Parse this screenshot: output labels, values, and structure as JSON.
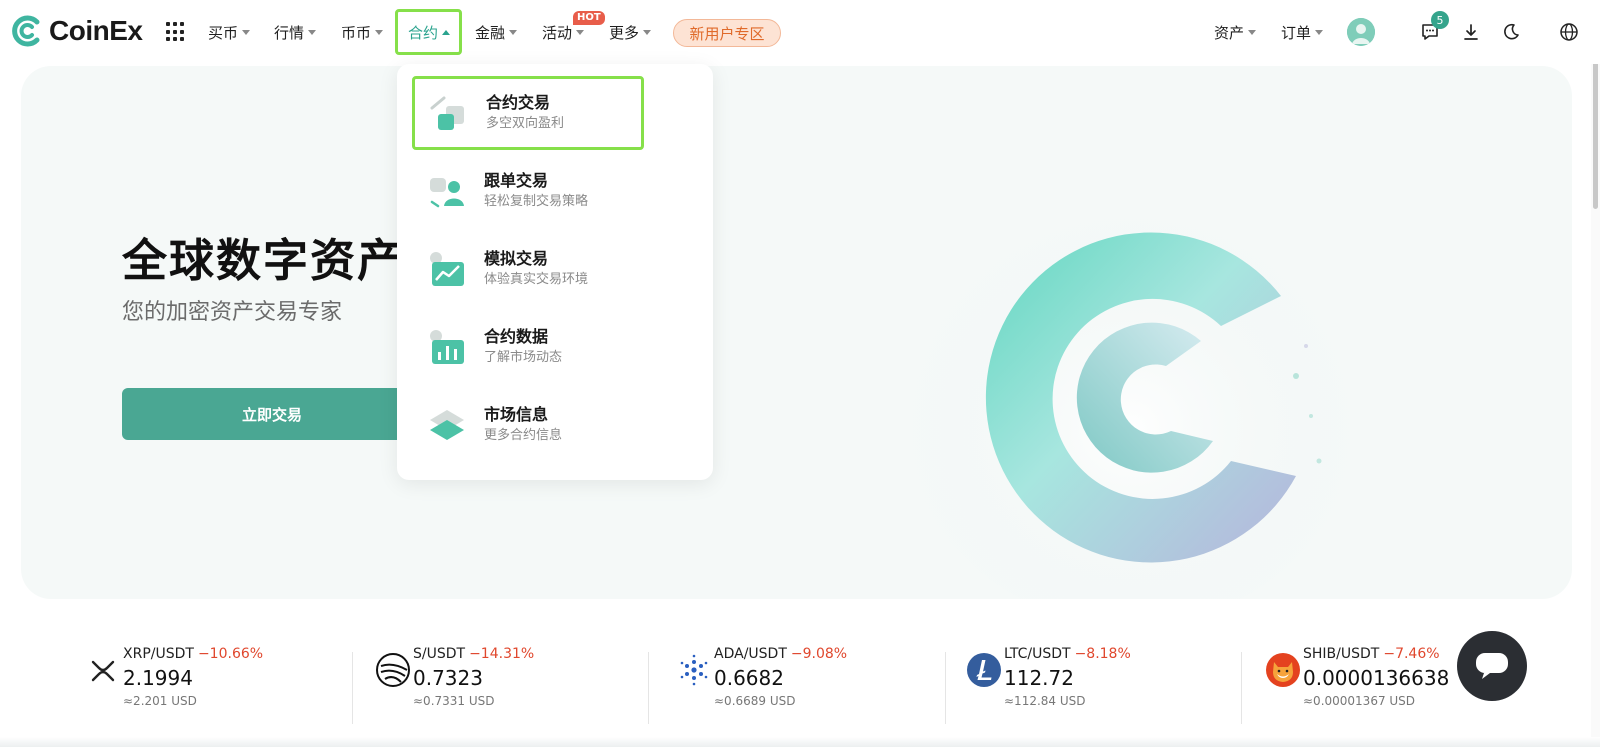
{
  "brand": {
    "name": "CoinEx",
    "colors": {
      "accent": "#2aa38e",
      "highlight": "#86e04a",
      "negative": "#e0472d",
      "promo": "#e06a2a"
    }
  },
  "nav": {
    "items": [
      {
        "label": "买币"
      },
      {
        "label": "行情"
      },
      {
        "label": "币币"
      },
      {
        "label": "合约"
      },
      {
        "label": "金融"
      },
      {
        "label": "活动"
      },
      {
        "label": "更多"
      }
    ],
    "hot_badge": "HOT",
    "new_user": "新用户专区",
    "assets": "资产",
    "orders": "订单",
    "message_count": "5"
  },
  "hero": {
    "title": "全球数字资产交",
    "subtitle": "您的加密资产交易专家",
    "cta": "立即交易"
  },
  "dropdown": {
    "items": [
      {
        "title": "合约交易",
        "desc": "多空双向盈利",
        "icon": "futures-trade-icon"
      },
      {
        "title": "跟单交易",
        "desc": "轻松复制交易策略",
        "icon": "copy-trade-icon"
      },
      {
        "title": "模拟交易",
        "desc": "体验真实交易环境",
        "icon": "demo-trade-icon"
      },
      {
        "title": "合约数据",
        "desc": "了解市场动态",
        "icon": "futures-data-icon"
      },
      {
        "title": "市场信息",
        "desc": "更多合约信息",
        "icon": "market-info-icon"
      }
    ]
  },
  "ticker": [
    {
      "pair": "XRP/USDT",
      "change": "−10.66%",
      "price": "2.1994",
      "usd": "≈2.201 USD",
      "icon": "xrp-icon"
    },
    {
      "pair": "S/USDT",
      "change": "−14.31%",
      "price": "0.7323",
      "usd": "≈0.7331 USD",
      "icon": "sonic-icon"
    },
    {
      "pair": "ADA/USDT",
      "change": "−9.08%",
      "price": "0.6682",
      "usd": "≈0.6689 USD",
      "icon": "cardano-icon"
    },
    {
      "pair": "LTC/USDT",
      "change": "−8.18%",
      "price": "112.72",
      "usd": "≈112.84 USD",
      "icon": "litecoin-icon"
    },
    {
      "pair": "SHIB/USDT",
      "change": "−7.46%",
      "price": "0.0000136638",
      "usd": "≈0.00001367 USD",
      "icon": "shiba-icon"
    }
  ]
}
